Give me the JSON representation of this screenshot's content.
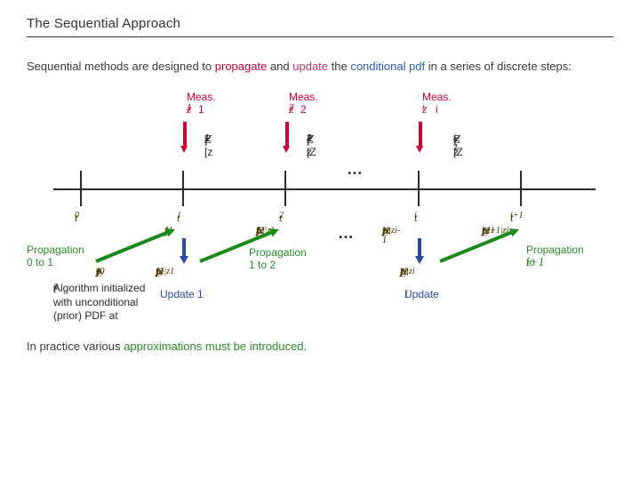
{
  "title": "The Sequential Approach",
  "intro_plain1": "Sequential methods are designed to ",
  "intro_em1": "propagate",
  "intro_plain2": " and ",
  "intro_em2": "update",
  "intro_plain3": " the ",
  "intro_em3": "conditional pdf",
  "intro_plain4": " in a series of discrete steps:",
  "meas1_l1": "Meas. 1",
  "meas1_l2": "z",
  "meas1_sub": "1",
  "meas2_l1": "Meas. 2",
  "meas2_l2": "z",
  "meas2_sub": "2",
  "measi_l1": "Meas. i",
  "measi_l2": "z",
  "measi_sub": "i",
  "Z1_l": "Z",
  "Z1_sub": "1",
  "Z1_eq": "= [z",
  "Z1_eqsub": "1",
  "Z1_end": "]",
  "Z2_l": "Z",
  "Z2_sub": "2",
  "Z2_eq": " = [Z",
  "Z2_eqsub1": "1",
  "Z2_mid": " , z",
  "Z2_eqsub2": "2",
  "Z2_end": " ]",
  "Zi_l": "Z",
  "Zi_sub": "i",
  "Zi_eq": " = [Z",
  "Zi_eqsub1": "i-1",
  "Zi_mid": " , z",
  "Zi_eqsub2": "i",
  "Zi_end": " ]",
  "t0": "t",
  "t0s": "0",
  "t1": "t",
  "t1s": "1",
  "t2": "t",
  "t2s": "2",
  "ti": "t",
  "tis": "i",
  "tip1": "t",
  "tip1s": "i+1",
  "p1": "p",
  "p1sub": "y1",
  "p1arg": "[y",
  "p1argsub": "1",
  "p1end": "]",
  "p2": "p",
  "p2sub": "y2|z1",
  "p2arg": "[y",
  "p2argsub": "2",
  "p2mid": "|Z",
  "p2midsub": "1",
  "p2end": "]",
  "pi": "p",
  "pisub": "yi|zi-1",
  "piarg": "[y",
  "piargsub": "i",
  "pimid": "|Z",
  "pimidsub": "i-1",
  "piend": "]",
  "pip1": "p",
  "pip1sub": "y,i+1|zi",
  "pip1arg": "[y",
  "pip1argsub": "i+1",
  "pip1mid": "|Z",
  "pip1midsub": "i",
  "pip1end": "]",
  "py0": "p",
  "py0sub": "y0",
  "py0arg": "[y",
  "py0argsub": "0",
  "py0end": "]",
  "py1z1": "p",
  "py1z1sub": "y1|z1",
  "py1z1arg": "[y",
  "py1z1argsub": "1",
  "py1z1mid": "|Z",
  "py1z1midsub": "1",
  "py1z1end": "]",
  "pyizi": "p",
  "pyizisub": "yi|zi",
  "pyiziarg": "[y",
  "pyiziargsub": "i",
  "pyizimid": "|Z",
  "pyizimidsub": "i",
  "pyiziend": "]",
  "prop01_l1": "Propagation",
  "prop01_l2": "0 to 1",
  "prop12_l1": "Propagation",
  "prop12_l2": "1 to 2",
  "propi_l1": "Propagation",
  "propi_l2_a": "i",
  "propi_l2_b": " to ",
  "propi_l2_c": "i+1",
  "upd1": "Update 1",
  "updi_a": "Update ",
  "updi_b": "i",
  "algnote_a": "Algorithm initialized with unconditional (prior) PDF at ",
  "algnote_b": "t",
  "algnote_bsub": "0",
  "dots": "…",
  "closing_a": "In practice various ",
  "closing_b": "approximations must be introduced",
  "closing_c": "."
}
